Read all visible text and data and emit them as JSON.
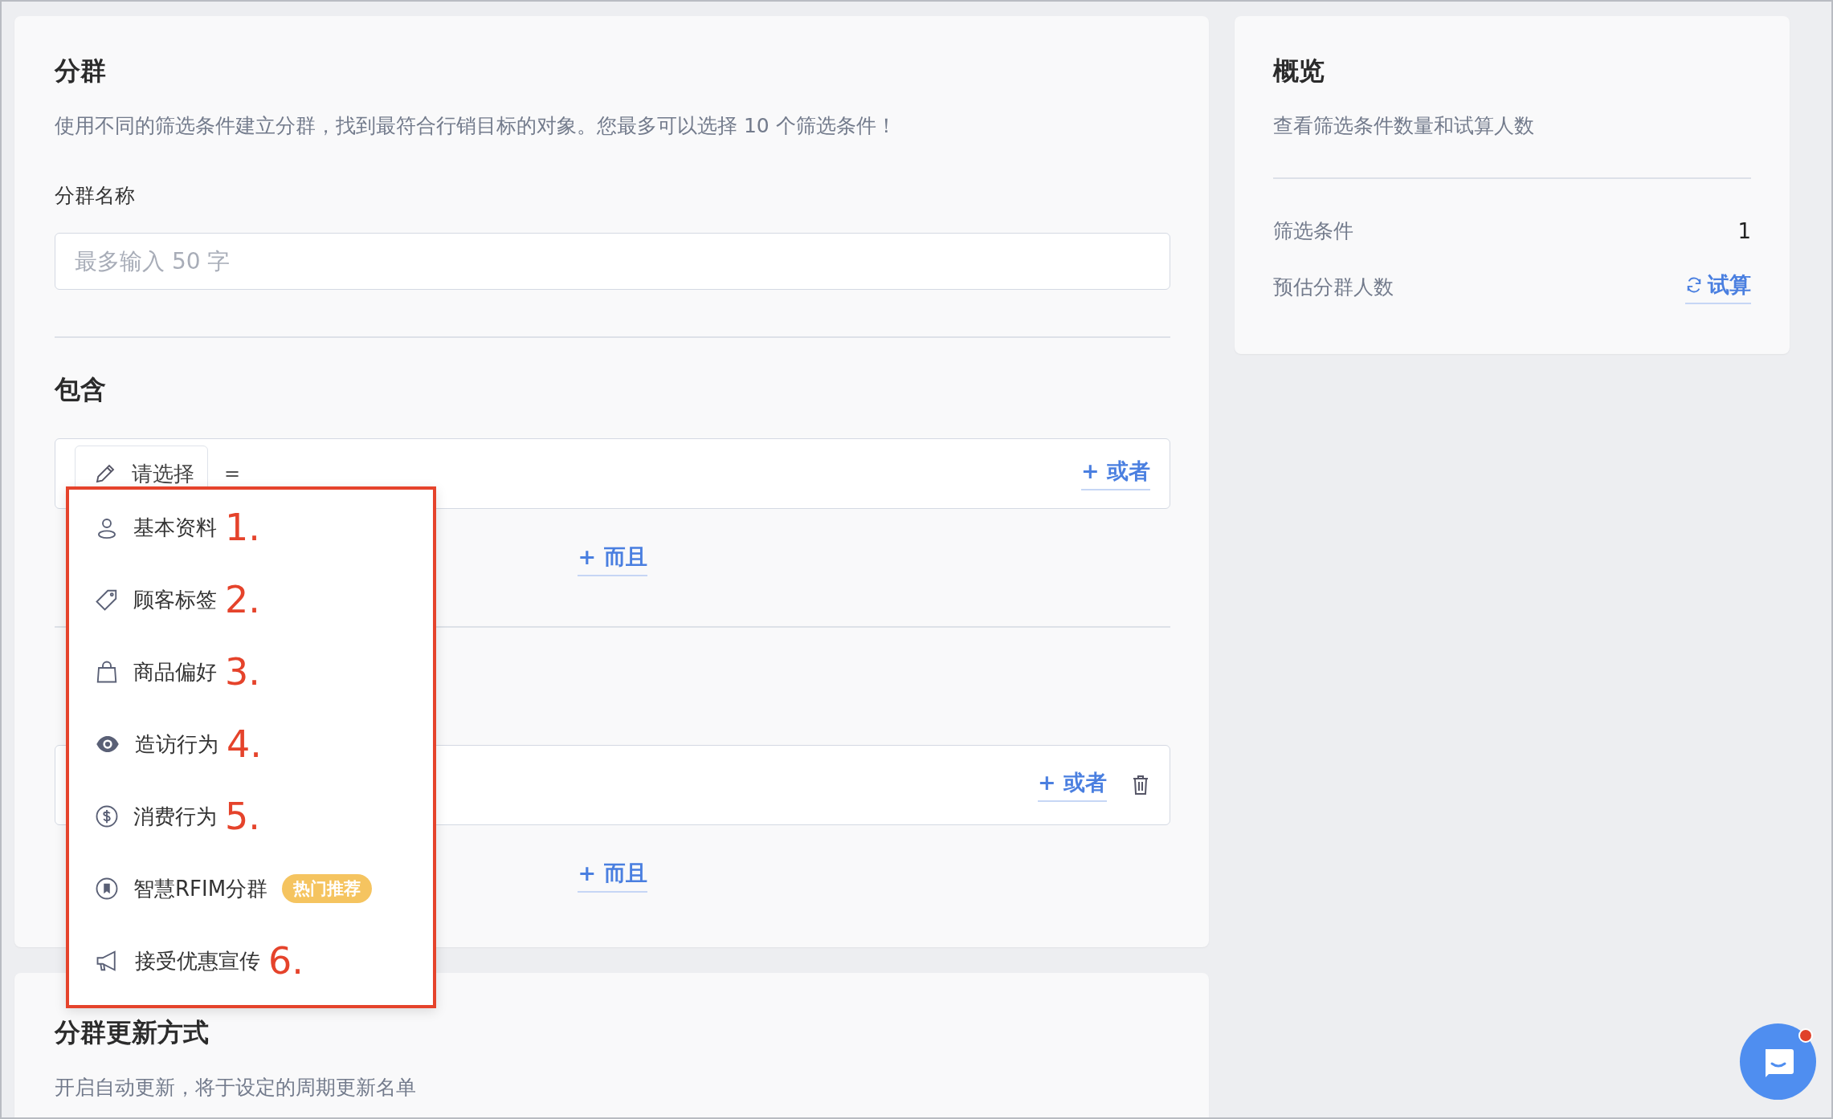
{
  "segment_card": {
    "title": "分群",
    "description": "使用不同的筛选条件建立分群，找到最符合行销目标的对象。您最多可以选择 10 个筛选条件！",
    "name_label": "分群名称",
    "name_field": {
      "placeholder": "最多输入 50 字"
    }
  },
  "include_section": {
    "title": "包含",
    "condition": {
      "selector": "请选择",
      "operator": "=",
      "or_link": "+ 或者"
    },
    "and_link": "+ 而且"
  },
  "exclude_section": {
    "condition": {
      "or_link": "+ 或者"
    },
    "and_link": "+ 而且"
  },
  "dropdown": {
    "items": [
      {
        "kind": "person",
        "label": "基本资料",
        "annotation": "1."
      },
      {
        "kind": "tag",
        "label": "顾客标签",
        "annotation": "2."
      },
      {
        "kind": "bag",
        "label": "商品偏好",
        "annotation": "3."
      },
      {
        "kind": "eye",
        "label": "造访行为",
        "annotation": "4."
      },
      {
        "kind": "dollar",
        "label": "消费行为",
        "annotation": "5."
      },
      {
        "kind": "bookmark",
        "label": "智慧RFIM分群",
        "badge": "热门推荐"
      },
      {
        "kind": "megaphone",
        "label": "接受优惠宣传",
        "annotation": "6."
      }
    ]
  },
  "overview": {
    "title": "概览",
    "description": "查看筛选条件数量和试算人数",
    "rows": [
      {
        "kind": "value",
        "label": "筛选条件",
        "value": "1"
      },
      {
        "kind": "action",
        "label": "预估分群人数",
        "action": "试算"
      }
    ]
  },
  "update_card": {
    "title": "分群更新方式",
    "description": "开启自动更新，将于设定的周期更新名单"
  }
}
